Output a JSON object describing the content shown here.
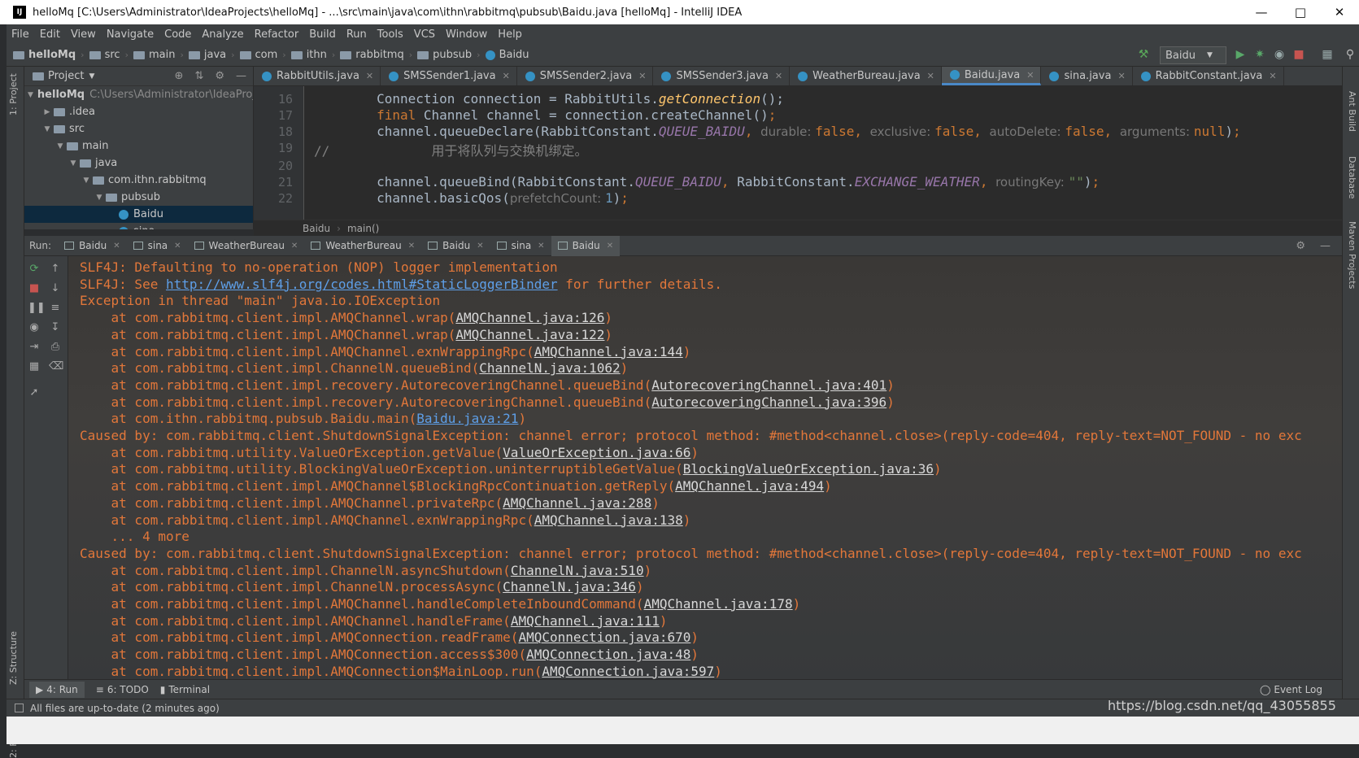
{
  "window": {
    "title": "helloMq [C:\\Users\\Administrator\\IdeaProjects\\helloMq] - ...\\src\\main\\java\\com\\ithn\\rabbitmq\\pubsub\\Baidu.java [helloMq] - IntelliJ IDEA",
    "app_icon": "IJ"
  },
  "menu": [
    "File",
    "Edit",
    "View",
    "Navigate",
    "Code",
    "Analyze",
    "Refactor",
    "Build",
    "Run",
    "Tools",
    "VCS",
    "Window",
    "Help"
  ],
  "breadcrumbs": [
    "helloMq",
    "src",
    "main",
    "java",
    "com",
    "ithn",
    "rabbitmq",
    "pubsub",
    "Baidu"
  ],
  "run_config": "Baidu",
  "project": {
    "header": "Project",
    "tree": [
      {
        "label": "helloMq",
        "path": "C:\\Users\\Administrator\\IdeaProj",
        "arrow": "▼",
        "indent": 0
      },
      {
        "label": ".idea",
        "arrow": "▶",
        "indent": 1
      },
      {
        "label": "src",
        "arrow": "▼",
        "indent": 1
      },
      {
        "label": "main",
        "arrow": "▼",
        "indent": 2
      },
      {
        "label": "java",
        "arrow": "▼",
        "indent": 3
      },
      {
        "label": "com.ithn.rabbitmq",
        "arrow": "▼",
        "indent": 4
      },
      {
        "label": "pubsub",
        "arrow": "▼",
        "indent": 5
      },
      {
        "label": "Baidu",
        "arrow": "",
        "indent": 6,
        "selected": true
      },
      {
        "label": "sina",
        "arrow": "",
        "indent": 6
      }
    ]
  },
  "left_tabs": {
    "project": "1: Project",
    "structure": "Z: Structure",
    "favorites": "2: Favorites"
  },
  "right_tabs": {
    "ant": "Ant Build",
    "database": "Database",
    "maven": "Maven Projects"
  },
  "editor_tabs": [
    "RabbitUtils.java",
    "SMSSender1.java",
    "SMSSender2.java",
    "SMSSender3.java",
    "WeatherBureau.java",
    "Baidu.java",
    "sina.java",
    "RabbitConstant.java"
  ],
  "editor_active_tab": "Baidu.java",
  "editor": {
    "line_numbers": [
      "16",
      "17",
      "18",
      "19",
      "20",
      "21",
      "22"
    ],
    "breadcrumb": [
      "Baidu",
      "main()"
    ]
  },
  "run": {
    "label": "Run:",
    "tabs": [
      "Baidu",
      "sina",
      "WeatherBureau",
      "WeatherBureau",
      "Baidu",
      "sina",
      "Baidu"
    ],
    "active_index": 6
  },
  "console": [
    {
      "t": "SLF4J: Defaulting to no-operation (NOP) logger implementation"
    },
    {
      "t": "SLF4J: See ",
      "url": "http://www.slf4j.org/codes.html#StaticLoggerBinder",
      "after": " for further details."
    },
    {
      "t": "Exception in thread \"main\" java.io.IOException"
    },
    {
      "t": "    at com.rabbitmq.client.impl.AMQChannel.wrap(",
      "link": "AMQChannel.java:126",
      "after": ")"
    },
    {
      "t": "    at com.rabbitmq.client.impl.AMQChannel.wrap(",
      "link": "AMQChannel.java:122",
      "after": ")"
    },
    {
      "t": "    at com.rabbitmq.client.impl.AMQChannel.exnWrappingRpc(",
      "link": "AMQChannel.java:144",
      "after": ")"
    },
    {
      "t": "    at com.rabbitmq.client.impl.ChannelN.queueBind(",
      "link": "ChannelN.java:1062",
      "after": ")"
    },
    {
      "t": "    at com.rabbitmq.client.impl.recovery.AutorecoveringChannel.queueBind(",
      "link": "AutorecoveringChannel.java:401",
      "after": ")"
    },
    {
      "t": "    at com.rabbitmq.client.impl.recovery.AutorecoveringChannel.queueBind(",
      "link": "AutorecoveringChannel.java:396",
      "after": ")"
    },
    {
      "t": "    at com.ithn.rabbitmq.pubsub.Baidu.main(",
      "url": "Baidu.java:21",
      "after": ")"
    },
    {
      "t": "Caused by: com.rabbitmq.client.ShutdownSignalException: channel error; protocol method: #method<channel.close>(reply-code=404, reply-text=NOT_FOUND - no exc"
    },
    {
      "t": "    at com.rabbitmq.utility.ValueOrException.getValue(",
      "link": "ValueOrException.java:66",
      "after": ")"
    },
    {
      "t": "    at com.rabbitmq.utility.BlockingValueOrException.uninterruptibleGetValue(",
      "link": "BlockingValueOrException.java:36",
      "after": ")"
    },
    {
      "t": "    at com.rabbitmq.client.impl.AMQChannel$BlockingRpcContinuation.getReply(",
      "link": "AMQChannel.java:494",
      "after": ")"
    },
    {
      "t": "    at com.rabbitmq.client.impl.AMQChannel.privateRpc(",
      "link": "AMQChannel.java:288",
      "after": ")"
    },
    {
      "t": "    at com.rabbitmq.client.impl.AMQChannel.exnWrappingRpc(",
      "link": "AMQChannel.java:138",
      "after": ")"
    },
    {
      "t": "    ... 4 more"
    },
    {
      "t": "Caused by: com.rabbitmq.client.ShutdownSignalException: channel error; protocol method: #method<channel.close>(reply-code=404, reply-text=NOT_FOUND - no exc"
    },
    {
      "t": "    at com.rabbitmq.client.impl.ChannelN.asyncShutdown(",
      "link": "ChannelN.java:510",
      "after": ")"
    },
    {
      "t": "    at com.rabbitmq.client.impl.ChannelN.processAsync(",
      "link": "ChannelN.java:346",
      "after": ")"
    },
    {
      "t": "    at com.rabbitmq.client.impl.AMQChannel.handleCompleteInboundCommand(",
      "link": "AMQChannel.java:178",
      "after": ")"
    },
    {
      "t": "    at com.rabbitmq.client.impl.AMQChannel.handleFrame(",
      "link": "AMQChannel.java:111",
      "after": ")"
    },
    {
      "t": "    at com.rabbitmq.client.impl.AMQConnection.readFrame(",
      "link": "AMQConnection.java:670",
      "after": ")"
    },
    {
      "t": "    at com.rabbitmq.client.impl.AMQConnection.access$300(",
      "link": "AMQConnection.java:48",
      "after": ")"
    },
    {
      "t": "    at com.rabbitmq.client.impl.AMQConnection$MainLoop.run(",
      "link": "AMQConnection.java:597",
      "after": ")"
    }
  ],
  "bottom_tabs": {
    "run": "4: Run",
    "todo": "6: TODO",
    "terminal": "Terminal",
    "event_log": "Event Log"
  },
  "status": "All files are up-to-date (2 minutes ago)",
  "watermark": "https://blog.csdn.net/qq_43055855",
  "colors": {
    "console_error": "#e2773a",
    "link": "#5e9fe8",
    "accent": "#4a88c7"
  }
}
